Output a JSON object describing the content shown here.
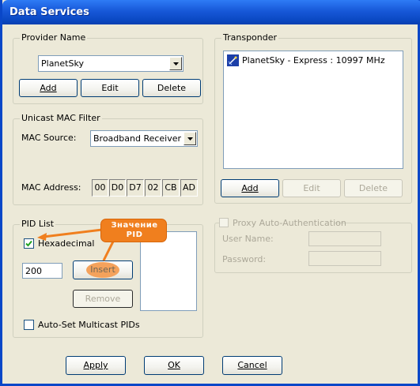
{
  "window": {
    "title": "Data Services"
  },
  "provider": {
    "legend": "Provider Name",
    "selected": "PlanetSky",
    "buttons": {
      "add": "Add",
      "edit": "Edit",
      "delete": "Delete"
    }
  },
  "transponder": {
    "legend": "Transponder",
    "items": [
      {
        "label": "PlanetSky - Express : 10997 MHz",
        "icon": "satellite-icon"
      }
    ],
    "buttons": {
      "add": "Add",
      "edit": "Edit",
      "delete": "Delete"
    }
  },
  "mac": {
    "legend": "Unicast MAC Filter",
    "source_label": "MAC Source:",
    "source_value": "Broadband Receiver",
    "address_label": "MAC Address:",
    "octets": [
      "00",
      "D0",
      "D7",
      "02",
      "CB",
      "AD"
    ]
  },
  "pid": {
    "legend": "PID List",
    "hexadecimal_label": "Hexadecimal",
    "hexadecimal_checked": true,
    "value": "200",
    "insert_label": "Insert",
    "remove_label": "Remove",
    "auto_set_label": "Auto-Set Multicast PIDs",
    "auto_set_checked": false
  },
  "proxy": {
    "legend": "Proxy Auto-Authentication",
    "enabled": false,
    "username_label": "User Name:",
    "password_label": "Password:"
  },
  "annotation": {
    "line1": "Значение",
    "line2": "PID",
    "color": "#F07F1E"
  },
  "footer": {
    "apply": "Apply",
    "ok": "OK",
    "cancel": "Cancel"
  },
  "colors": {
    "title_bar": "#0A47C8",
    "dialog_bg": "#ECE9D8",
    "accent": "#F07F1E"
  }
}
